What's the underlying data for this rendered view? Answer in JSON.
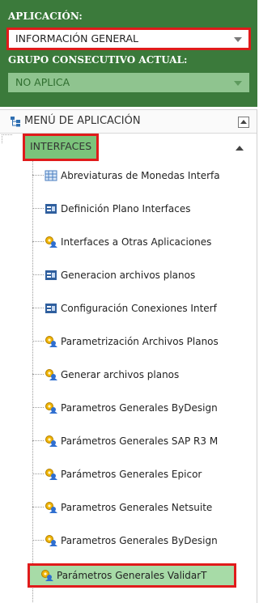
{
  "application": {
    "label": "APLICACIÓN:",
    "value": "INFORMACIÓN GENERAL"
  },
  "group": {
    "label": "GRUPO CONSECUTIVO ACTUAL:",
    "value": "NO APLICA"
  },
  "menu": {
    "title": "MENÚ DE APLICACIÓN",
    "root": "INTERFACES",
    "items": [
      {
        "label": "Abreviaturas de Monedas Interfa",
        "icon": "grid-icon"
      },
      {
        "label": "Definición Plano Interfaces",
        "icon": "form-icon"
      },
      {
        "label": "Interfaces a Otras Aplicaciones",
        "icon": "gear-user-icon"
      },
      {
        "label": "Generacion archivos planos",
        "icon": "form-icon"
      },
      {
        "label": "Configuración Conexiones Interf",
        "icon": "form-icon"
      },
      {
        "label": "Parametrización Archivos Planos",
        "icon": "gear-user-icon"
      },
      {
        "label": "Generar archivos planos",
        "icon": "gear-user-icon"
      },
      {
        "label": "Parametros Generales ByDesign",
        "icon": "gear-user-icon"
      },
      {
        "label": "Parámetros Generales SAP R3 M",
        "icon": "gear-user-icon"
      },
      {
        "label": "Parámetros Generales Epicor",
        "icon": "gear-user-icon"
      },
      {
        "label": "Parametros Generales Netsuite",
        "icon": "gear-user-icon"
      },
      {
        "label": "Parametros Generales ByDesign",
        "icon": "gear-user-icon"
      },
      {
        "label": "Parámetros Generales ValidarT",
        "icon": "gear-user-icon"
      }
    ]
  },
  "colors": {
    "panel_green": "#3b7a3b",
    "highlight_red": "#e01b1b",
    "selected_green": "#a7dba7"
  }
}
